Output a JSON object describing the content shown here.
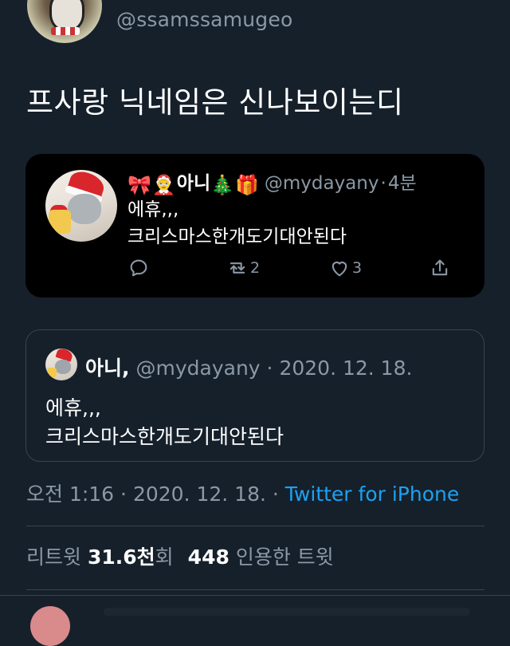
{
  "author": {
    "handle": "@ssamssamugeo"
  },
  "tweet": {
    "text": "프사랑 닉네임은 신나보이는디"
  },
  "embedded_screenshot": {
    "name_emojis_before": [
      "🎀",
      "🤶"
    ],
    "name": "아니",
    "name_emojis_after": [
      "🎄",
      "🎁"
    ],
    "handle": "@mydayany",
    "separator": "·",
    "time": "4분",
    "lines": [
      "에휴,,,",
      "크리스마스한개도기대안된다"
    ],
    "actions": {
      "reply_icon": "reply-icon",
      "retweet_icon": "retweet-icon",
      "retweet_count": "2",
      "like_icon": "heart-icon",
      "like_count": "3",
      "share_icon": "share-icon"
    }
  },
  "quoted_tweet": {
    "name": "아니,",
    "handle": "@mydayany",
    "separator": "·",
    "date": "2020. 12. 18.",
    "lines": [
      "에휴,,,",
      "크리스마스한개도기대안된다"
    ]
  },
  "meta": {
    "time": "오전 1:16",
    "sep1": "·",
    "date": "2020. 12. 18.",
    "sep2": "·",
    "source": "Twitter for iPhone"
  },
  "stats": {
    "retweet_label": "리트윗",
    "retweet_count": "31.6천",
    "retweet_suffix": "회",
    "quote_count": "448",
    "quote_label": "인용한 트윗"
  },
  "colors": {
    "background": "#15202b",
    "secondary_text": "#8b98a5",
    "link": "#1da1f2",
    "border": "#38444d"
  }
}
